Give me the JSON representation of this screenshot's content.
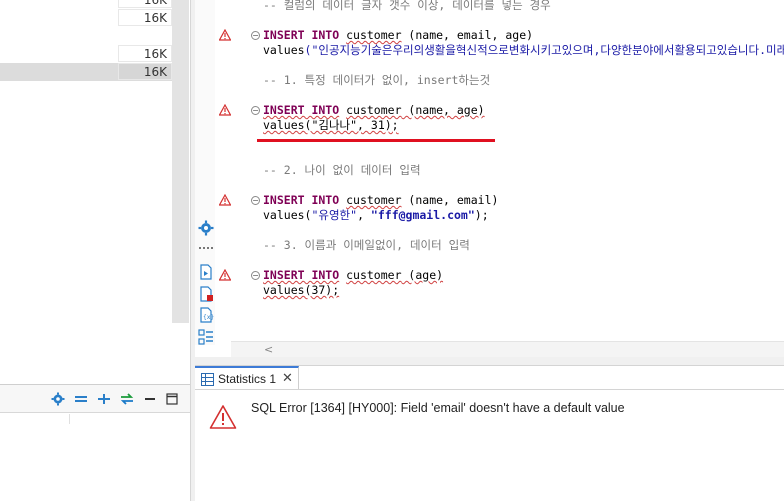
{
  "file_panel": {
    "size_values": [
      "16K",
      "16K",
      "16K",
      "16K"
    ]
  },
  "editor": {
    "lines": {
      "comment_overflow": "-- 컬럼의 데이터 글자 갯수 이상, 데이터를 넣는 경우",
      "insert_1_kw": "INSERT INTO",
      "insert_1_table": "customer",
      "insert_1_cols": " (name, email, age)",
      "values_1_fn": "values",
      "values_1_str": "(\"인공지능기술은우리의생활을혁신적으로변화시키고있으며,다양한분야에서활용되고있습니다.미래의가",
      "comment_1": "-- 1. 특정 데이터가 없이, insert하는것",
      "insert_2_kw": "INSERT INTO",
      "insert_2_table": "customer",
      "insert_2_cols": " (name, age)",
      "values_2": "values(\"김나나\", 31);",
      "comment_2": "-- 2. 나이 없이 데이터 입력",
      "insert_3_kw": "INSERT INTO",
      "insert_3_table": "customer",
      "insert_3_cols": " (name, email)",
      "values_3_fn": "values(",
      "values_3_str1": "\"유영한\"",
      "values_3_mid": ", ",
      "values_3_str2": "\"fff@gmail.com\"",
      "values_3_end": ");",
      "comment_3": "-- 3. 이름과 이메일없이, 데이터 입력",
      "insert_4_kw": "INSERT INTO",
      "insert_4_table": "customer",
      "insert_4_cols": " (age)",
      "values_4": "values(37);"
    },
    "scroll_left_glyph": "<"
  },
  "results": {
    "tab_label": "Statistics 1",
    "tab_close": "✕",
    "error_message": "SQL Error [1364] [HY000]: Field 'email' doesn't have a default value"
  },
  "colors": {
    "keyword": "#7f0055",
    "error_underline": "#e01020",
    "accent": "#3d7bd6"
  },
  "icons": [
    "gear-icon",
    "filter-icon",
    "add-filter-icon",
    "link-arrows-icon",
    "minimize-icon",
    "maximize-icon",
    "warning-icon",
    "error-icon",
    "table-icon"
  ]
}
